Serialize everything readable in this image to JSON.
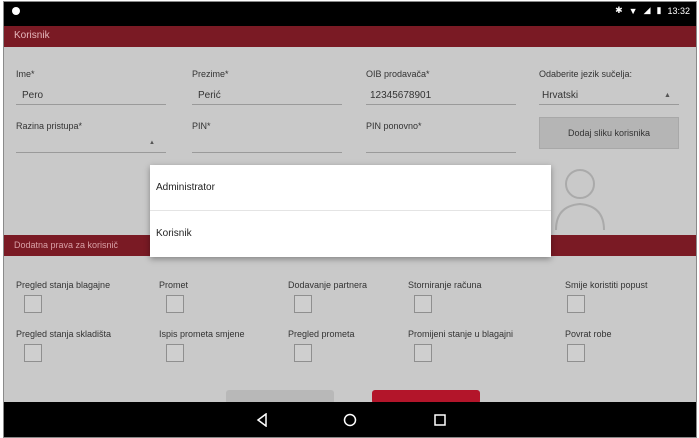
{
  "status_bar": {
    "time": "13:32"
  },
  "form": {
    "section_title": "Korisnik",
    "ime_label": "Ime*",
    "ime_value": "Pero",
    "prezime_label": "Prezime*",
    "prezime_value": "Perić",
    "oib_label": "OIB prodavača*",
    "oib_value": "12345678901",
    "language_label": "Odaberite jezik sučelja:",
    "language_value": "Hrvatski",
    "razina_label": "Razina pristupa*",
    "pin_label": "PIN*",
    "pin_repeat_label": "PIN ponovno*",
    "photo_button_label": "Dodaj sliku korisnika"
  },
  "rights": {
    "section_title": "Dodatna prava za korisnič",
    "permissions": [
      {
        "label": "Pregled stanja blagajne",
        "checked": false
      },
      {
        "label": "Promet",
        "checked": false
      },
      {
        "label": "Dodavanje partnera",
        "checked": false
      },
      {
        "label": "Storniranje računa",
        "checked": false
      },
      {
        "label": "Smije koristiti popust",
        "checked": false
      },
      {
        "label": "Pregled stanja skladišta",
        "checked": false
      },
      {
        "label": "Ispis prometa smjene",
        "checked": false
      },
      {
        "label": "Pregled prometa",
        "checked": false
      },
      {
        "label": "Promijeni stanje u blagajni",
        "checked": false
      },
      {
        "label": "Povrat robe",
        "checked": false
      }
    ]
  },
  "dropdown": {
    "options": [
      "Administrator",
      "Korisnik"
    ]
  },
  "nav": {
    "back_icon": "◁",
    "home_icon": "○",
    "recents_icon": "□"
  },
  "colors": {
    "header_red": "#7a1a24",
    "background": "#c9c9c9",
    "accent_red": "#b3152a"
  }
}
